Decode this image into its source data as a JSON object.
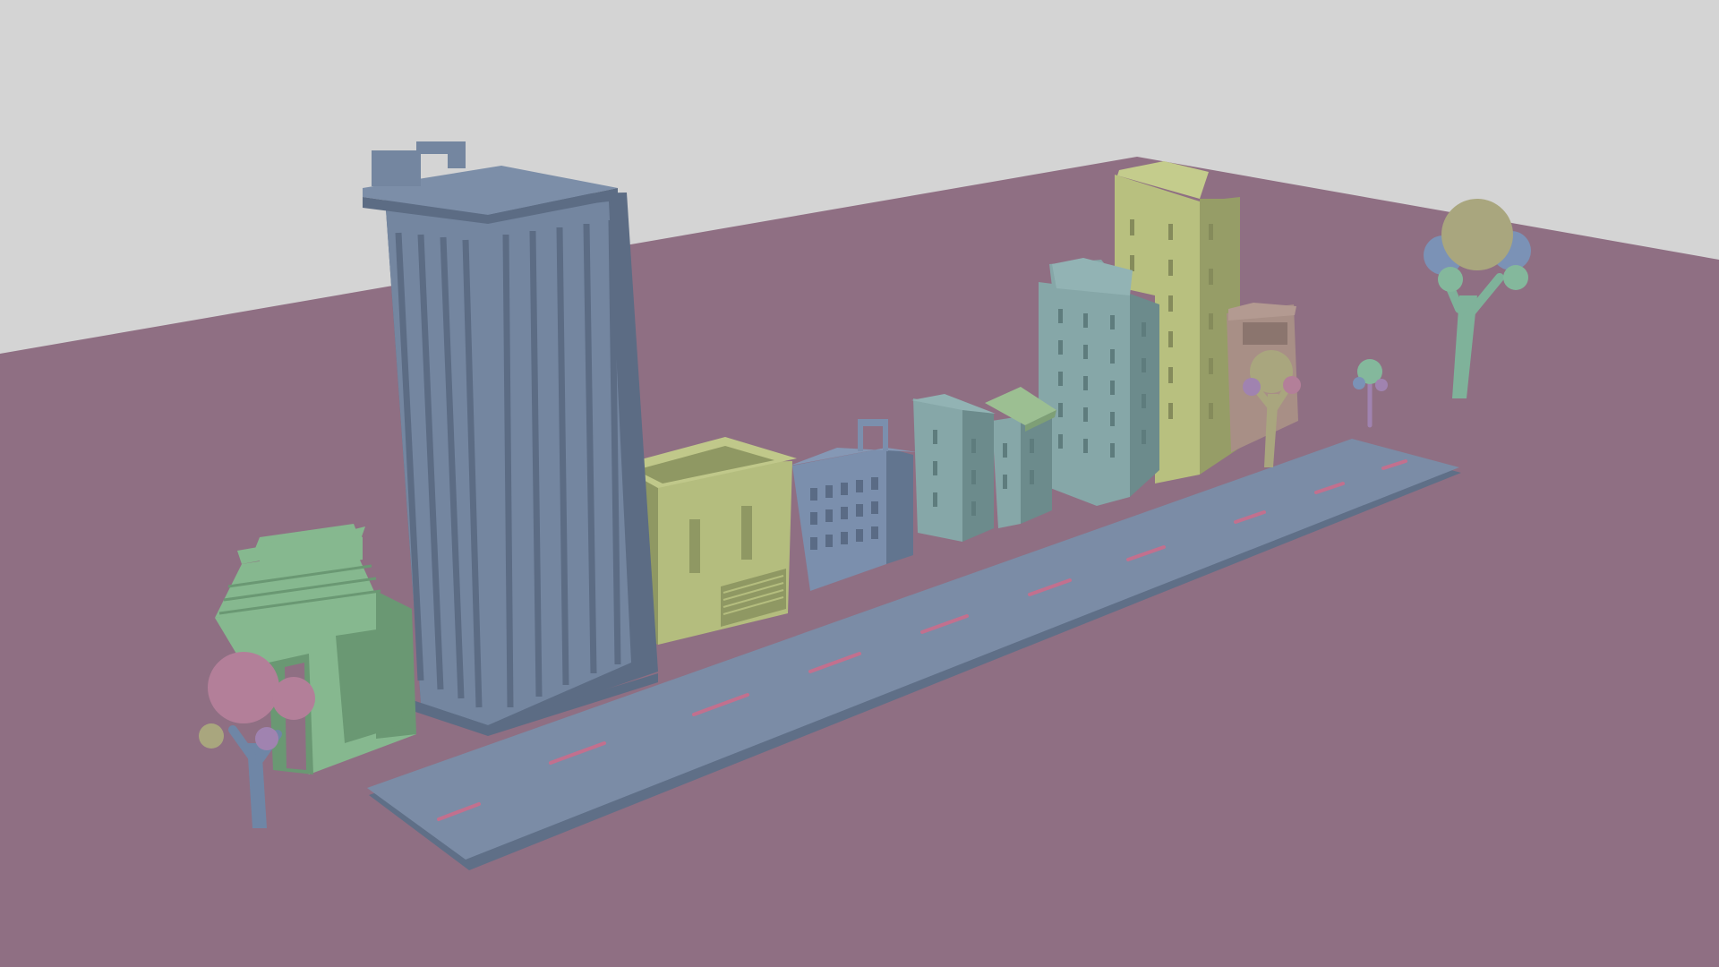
{
  "scene": {
    "colors": {
      "sky": "#d4d4d4",
      "ground": "#8f6f83",
      "road": "#7b8ca6",
      "road_edge": "#5f6f87",
      "road_dash": "#c2708e",
      "skyscraper": "#7486a0",
      "skyscraper_dark": "#5c6c84",
      "shop_green": "#b4bd7e",
      "shop_green_dark": "#8f9863",
      "blue_building": "#7b8fad",
      "teal_building": "#86a7a8",
      "teal_dark": "#6c8b8c",
      "yellow_tower": "#b8c07f",
      "brown_shop": "#a88f86",
      "arch_green": "#86b88f",
      "arch_dark": "#6a9873",
      "tree_trunk_blue": "#6f86a6",
      "tree_trunk_green": "#7fb29a",
      "canopy_pink": "#b37f99",
      "canopy_olive": "#a9a67e",
      "canopy_blue": "#7b92b6",
      "canopy_green": "#84b89c",
      "canopy_purple": "#a083b0"
    },
    "objects": [
      {
        "id": "skyscraper",
        "kind": "building"
      },
      {
        "id": "green-shop",
        "kind": "building"
      },
      {
        "id": "blue-apartment",
        "kind": "building"
      },
      {
        "id": "teal-small",
        "kind": "building"
      },
      {
        "id": "pitched-roof-house",
        "kind": "building"
      },
      {
        "id": "teal-tower",
        "kind": "building"
      },
      {
        "id": "yellow-tower",
        "kind": "building"
      },
      {
        "id": "brown-shop",
        "kind": "building"
      },
      {
        "id": "green-arch-gate",
        "kind": "structure"
      },
      {
        "id": "road",
        "kind": "road"
      },
      {
        "id": "pink-tree",
        "kind": "tree"
      },
      {
        "id": "olive-tree",
        "kind": "tree"
      },
      {
        "id": "small-tree",
        "kind": "tree"
      },
      {
        "id": "big-tree",
        "kind": "tree"
      }
    ]
  }
}
